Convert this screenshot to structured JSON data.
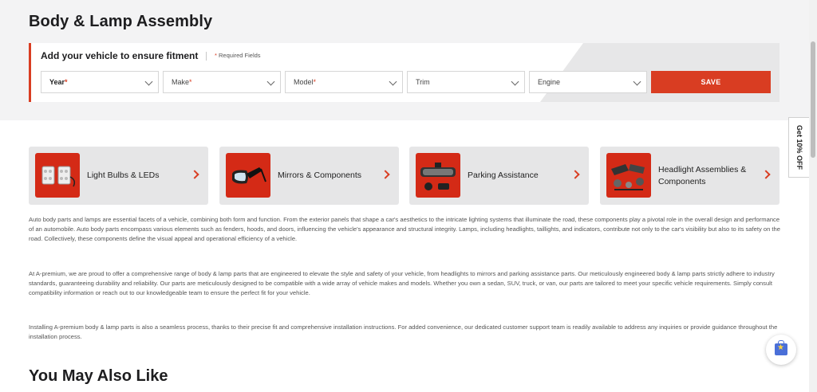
{
  "page": {
    "title": "Body & Lamp Assembly",
    "section_title": "You May Also Like"
  },
  "fitment": {
    "title": "Add your vehicle to ensure fitment",
    "required_star": "*",
    "required_note": "Required Fields",
    "selects": [
      {
        "label": "Year",
        "required": "*"
      },
      {
        "label": "Make",
        "required": "*"
      },
      {
        "label": "Model",
        "required": "*"
      },
      {
        "label": "Trim",
        "required": ""
      },
      {
        "label": "Engine",
        "required": ""
      }
    ],
    "save_label": "SAVE",
    "accent_color": "#d93d22"
  },
  "categories": [
    {
      "label": "Light Bulbs & LEDs",
      "icon": "light-bulbs-image"
    },
    {
      "label": "Mirrors & Components",
      "icon": "mirror-image"
    },
    {
      "label": "Parking Assistance",
      "icon": "parking-assistance-image"
    },
    {
      "label": "Headlight Assemblies & Components",
      "icon": "headlight-assembly-image"
    }
  ],
  "paragraphs": [
    "Auto body parts and lamps are essential facets of a vehicle, combining both form and function. From the exterior panels that shape a car's aesthetics to the intricate lighting systems that illuminate the road, these components play a pivotal role in the overall design and performance of an automobile. Auto body parts encompass various elements such as fenders, hoods, and doors, influencing the vehicle's appearance and structural integrity. Lamps, including headlights, taillights, and indicators, contribute not only to the car's visibility but also to its safety on the road. Collectively, these components define the visual appeal and operational efficiency of a vehicle.",
    "At A-premium, we are proud to offer a comprehensive range of body & lamp parts that are engineered to elevate the style and safety of your vehicle, from headlights to mirrors and parking assistance parts. Our meticulously engineered body & lamp parts strictly adhere to industry standards, guaranteeing durability and reliability. Our parts are meticulously designed to be compatible with a wide array of vehicle makes and models. Whether you own a sedan, SUV, truck, or van, our parts are tailored to meet your specific vehicle requirements. Simply consult compatibility information or reach out to our knowledgeable team to ensure the perfect fit for your vehicle.",
    "Installing A-premium body & lamp parts is also a seamless process, thanks to their precise fit and comprehensive installation instructions. For added convenience, our dedicated customer support team is readily available to address any inquiries or provide guidance throughout the installation process."
  ],
  "discount_tab": {
    "label": "Get 10% OFF"
  },
  "floating_button": {
    "icon": "shopping-bag-star-icon"
  }
}
